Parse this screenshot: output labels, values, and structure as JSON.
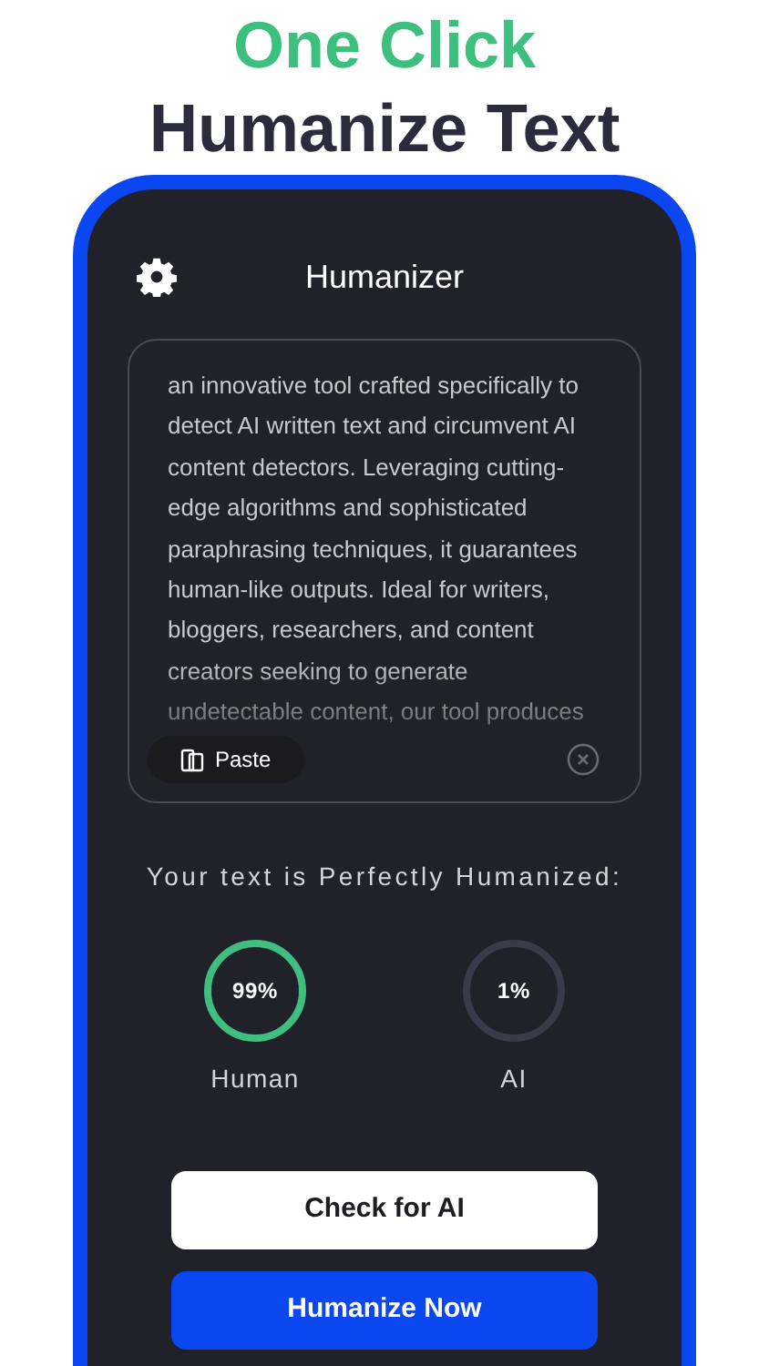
{
  "headline": {
    "line_1": "One Click",
    "line_2": "Humanize Text"
  },
  "app": {
    "title": "Humanizer",
    "input": {
      "value": "an innovative tool crafted specifically to detect AI written text and circumvent AI content detectors. Leveraging cutting-edge algorithms and sophisticated paraphrasing techniques, it guarantees human-like outputs. Ideal for writers, bloggers, researchers, and content creators seeking to generate undetectable content, our tool produces",
      "paste_button": "Paste"
    },
    "result_label": "Your text is Perfectly Humanized:",
    "scores": [
      {
        "value": "99%",
        "label": "Human",
        "color": "#3fbf7f"
      },
      {
        "value": "1%",
        "label": "AI",
        "color": "#3a3a4a"
      }
    ],
    "buttons": [
      {
        "label": "Check for AI",
        "kind": "secondary"
      },
      {
        "label": "Humanize Now",
        "kind": "primary"
      }
    ]
  }
}
